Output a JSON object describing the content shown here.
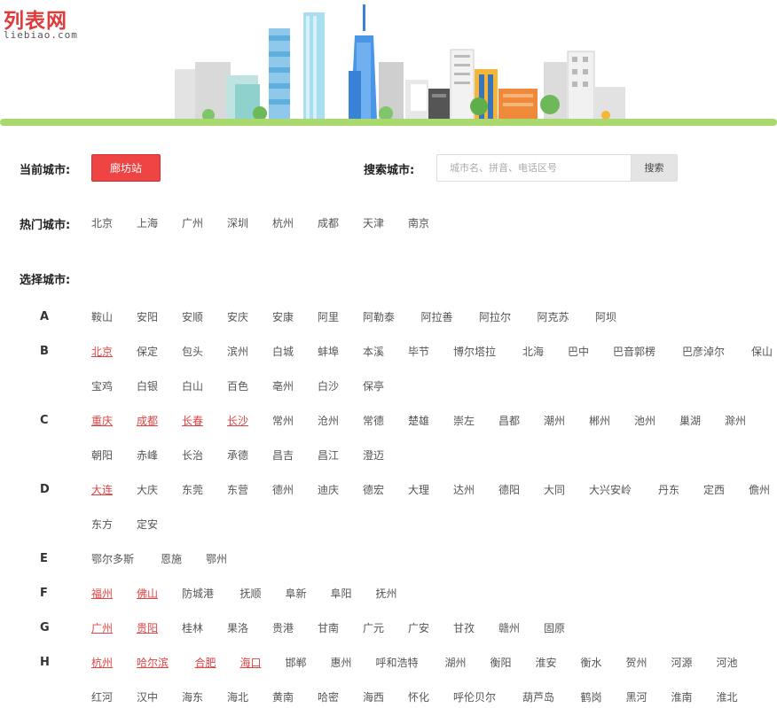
{
  "logo": {
    "name": "列表网",
    "domain": "liebiao.com"
  },
  "current": {
    "label": "当前城市:",
    "city": "廊坊站"
  },
  "search": {
    "label": "搜索城市:",
    "placeholder": "城市名、拼音、电话区号",
    "button": "搜索"
  },
  "hot": {
    "label": "热门城市:",
    "cities": [
      "北京",
      "上海",
      "广州",
      "深圳",
      "杭州",
      "成都",
      "天津",
      "南京"
    ]
  },
  "select": {
    "label": "选择城市:"
  },
  "colors": {
    "accent": "#ee4444",
    "highlight": "#e04545",
    "ground": "#a8d86e"
  },
  "groups": [
    {
      "letter": "A",
      "rows": [
        [
          {
            "name": "鞍山"
          },
          {
            "name": "安阳"
          },
          {
            "name": "安顺"
          },
          {
            "name": "安庆"
          },
          {
            "name": "安康"
          },
          {
            "name": "阿里"
          },
          {
            "name": "阿勒泰"
          },
          {
            "name": "阿拉善"
          },
          {
            "name": "阿拉尔"
          },
          {
            "name": "阿克苏"
          },
          {
            "name": "阿坝"
          }
        ]
      ]
    },
    {
      "letter": "B",
      "rows": [
        [
          {
            "name": "北京",
            "hot": true
          },
          {
            "name": "保定"
          },
          {
            "name": "包头"
          },
          {
            "name": "滨州"
          },
          {
            "name": "白城"
          },
          {
            "name": "蚌埠"
          },
          {
            "name": "本溪"
          },
          {
            "name": "毕节"
          },
          {
            "name": "博尔塔拉"
          },
          {
            "name": "北海"
          },
          {
            "name": "巴中"
          },
          {
            "name": "巴音郭楞"
          },
          {
            "name": "巴彦淖尔"
          },
          {
            "name": "保山"
          }
        ],
        [
          {
            "name": "宝鸡"
          },
          {
            "name": "白银"
          },
          {
            "name": "白山"
          },
          {
            "name": "百色"
          },
          {
            "name": "亳州"
          },
          {
            "name": "白沙"
          },
          {
            "name": "保亭"
          }
        ]
      ]
    },
    {
      "letter": "C",
      "rows": [
        [
          {
            "name": "重庆",
            "hot": true
          },
          {
            "name": "成都",
            "hot": true
          },
          {
            "name": "长春",
            "hot": true
          },
          {
            "name": "长沙",
            "hot": true
          },
          {
            "name": "常州"
          },
          {
            "name": "沧州"
          },
          {
            "name": "常德"
          },
          {
            "name": "楚雄"
          },
          {
            "name": "崇左"
          },
          {
            "name": "昌都"
          },
          {
            "name": "潮州"
          },
          {
            "name": "郴州"
          },
          {
            "name": "池州"
          },
          {
            "name": "巢湖"
          },
          {
            "name": "滁州"
          }
        ],
        [
          {
            "name": "朝阳"
          },
          {
            "name": "赤峰"
          },
          {
            "name": "长治"
          },
          {
            "name": "承德"
          },
          {
            "name": "昌吉"
          },
          {
            "name": "昌江"
          },
          {
            "name": "澄迈"
          }
        ]
      ]
    },
    {
      "letter": "D",
      "rows": [
        [
          {
            "name": "大连",
            "hot": true
          },
          {
            "name": "大庆"
          },
          {
            "name": "东莞"
          },
          {
            "name": "东营"
          },
          {
            "name": "德州"
          },
          {
            "name": "迪庆"
          },
          {
            "name": "德宏"
          },
          {
            "name": "大理"
          },
          {
            "name": "达州"
          },
          {
            "name": "德阳"
          },
          {
            "name": "大同"
          },
          {
            "name": "大兴安岭"
          },
          {
            "name": "丹东"
          },
          {
            "name": "定西"
          },
          {
            "name": "儋州"
          }
        ],
        [
          {
            "name": "东方"
          },
          {
            "name": "定安"
          }
        ]
      ]
    },
    {
      "letter": "E",
      "rows": [
        [
          {
            "name": "鄂尔多斯"
          },
          {
            "name": "恩施"
          },
          {
            "name": "鄂州"
          }
        ]
      ]
    },
    {
      "letter": "F",
      "rows": [
        [
          {
            "name": "福州",
            "hot": true
          },
          {
            "name": "佛山",
            "hot": true
          },
          {
            "name": "防城港"
          },
          {
            "name": "抚顺"
          },
          {
            "name": "阜新"
          },
          {
            "name": "阜阳"
          },
          {
            "name": "抚州"
          }
        ]
      ]
    },
    {
      "letter": "G",
      "rows": [
        [
          {
            "name": "广州",
            "hot": true
          },
          {
            "name": "贵阳",
            "hot": true
          },
          {
            "name": "桂林"
          },
          {
            "name": "果洛"
          },
          {
            "name": "贵港"
          },
          {
            "name": "甘南"
          },
          {
            "name": "广元"
          },
          {
            "name": "广安"
          },
          {
            "name": "甘孜"
          },
          {
            "name": "赣州"
          },
          {
            "name": "固原"
          }
        ]
      ]
    },
    {
      "letter": "H",
      "rows": [
        [
          {
            "name": "杭州",
            "hot": true
          },
          {
            "name": "哈尔滨",
            "hot": true
          },
          {
            "name": "合肥",
            "hot": true
          },
          {
            "name": "海口",
            "hot": true
          },
          {
            "name": "邯郸"
          },
          {
            "name": "惠州"
          },
          {
            "name": "呼和浩特"
          },
          {
            "name": "湖州"
          },
          {
            "name": "衡阳"
          },
          {
            "name": "淮安"
          },
          {
            "name": "衡水"
          },
          {
            "name": "贺州"
          },
          {
            "name": "河源"
          },
          {
            "name": "河池"
          }
        ],
        [
          {
            "name": "红河"
          },
          {
            "name": "汉中"
          },
          {
            "name": "海东"
          },
          {
            "name": "海北"
          },
          {
            "name": "黄南"
          },
          {
            "name": "哈密"
          },
          {
            "name": "海西"
          },
          {
            "name": "怀化"
          },
          {
            "name": "呼伦贝尔"
          },
          {
            "name": "葫芦岛"
          },
          {
            "name": "鹤岗"
          },
          {
            "name": "黑河"
          },
          {
            "name": "淮南"
          },
          {
            "name": "淮北"
          }
        ]
      ]
    }
  ]
}
